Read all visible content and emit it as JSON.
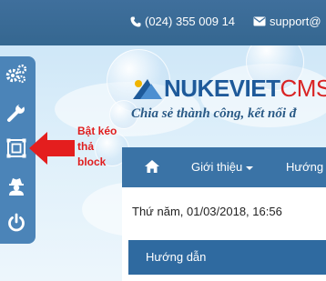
{
  "topbar": {
    "phone": "(024) 355 009 14",
    "email": "support@"
  },
  "logo": {
    "brand": "NUKEVIET",
    "suffix": "CMS",
    "slogan": "Chia sẻ thành công, kết nối đ"
  },
  "sidebar": {
    "tools": [
      {
        "icon": "cogs-icon"
      },
      {
        "icon": "wrench-icon"
      },
      {
        "icon": "block-drag-icon"
      },
      {
        "icon": "user-secret-icon"
      },
      {
        "icon": "power-icon"
      }
    ]
  },
  "annotation": {
    "line1": "Bật kéo",
    "line2": "thả",
    "line3": "block",
    "color": "#e01e1e"
  },
  "nav": {
    "items": [
      {
        "label": "Giới thiệu"
      },
      {
        "label": "Hướng"
      }
    ]
  },
  "date": "Thứ năm, 01/03/2018, 16:56",
  "block": {
    "title": "Hướng dẫn"
  },
  "colors": {
    "topbar": "#3f6f9c",
    "sidebar": "#4b84b8",
    "nav": "#3a73a6",
    "block": "#2f6aa0"
  }
}
